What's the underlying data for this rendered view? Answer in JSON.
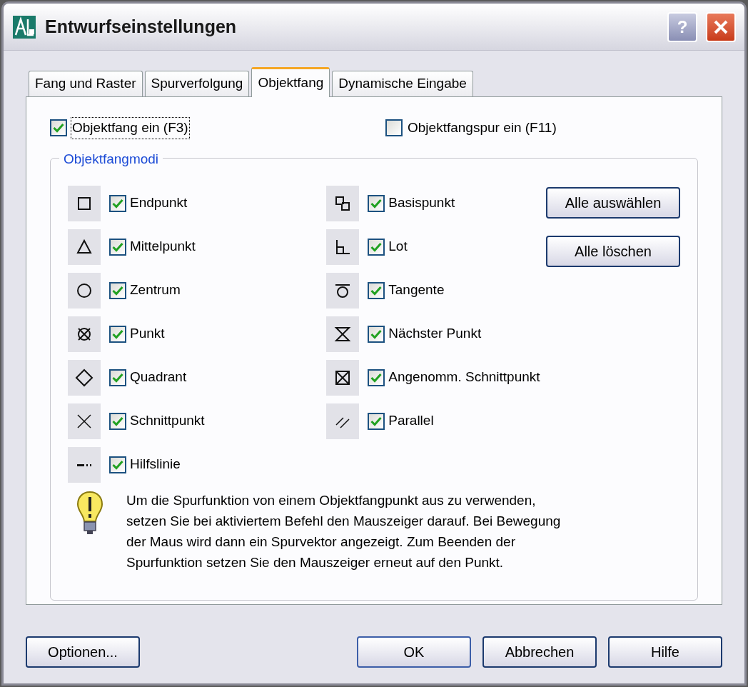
{
  "window": {
    "title": "Entwurfseinstellungen",
    "help_button": "?"
  },
  "tabs": [
    {
      "label": "Fang und Raster",
      "selected": false
    },
    {
      "label": "Spurverfolgung",
      "selected": false
    },
    {
      "label": "Objektfang",
      "selected": true
    },
    {
      "label": "Dynamische Eingabe",
      "selected": false
    }
  ],
  "top_options": [
    {
      "label": "Objektfang ein (F3)",
      "checked": true,
      "focused": true
    },
    {
      "label": "Objektfangspur ein (F11)",
      "checked": false,
      "focused": false
    }
  ],
  "group": {
    "title": "Objektfangmodi",
    "columns": [
      {
        "modes": [
          {
            "kind": "endpoint",
            "label": "Endpunkt",
            "checked": true
          },
          {
            "kind": "midpoint",
            "label": "Mittelpunkt",
            "checked": true
          },
          {
            "kind": "center",
            "label": "Zentrum",
            "checked": true
          },
          {
            "kind": "node",
            "label": "Punkt",
            "checked": true
          },
          {
            "kind": "quadrant",
            "label": "Quadrant",
            "checked": true
          },
          {
            "kind": "intersection",
            "label": "Schnittpunkt",
            "checked": true
          },
          {
            "kind": "extension",
            "label": "Hilfslinie",
            "checked": true
          }
        ]
      },
      {
        "modes": [
          {
            "kind": "insertion",
            "label": "Basispunkt",
            "checked": true
          },
          {
            "kind": "perpendicular",
            "label": "Lot",
            "checked": true
          },
          {
            "kind": "tangent",
            "label": "Tangente",
            "checked": true
          },
          {
            "kind": "nearest",
            "label": "Nächster Punkt",
            "checked": true
          },
          {
            "kind": "apparent",
            "label": "Angenomm. Schnittpunkt",
            "checked": true
          },
          {
            "kind": "parallel",
            "label": "Parallel",
            "checked": true
          }
        ]
      }
    ],
    "buttons": [
      "Alle auswählen",
      "Alle löschen"
    ],
    "hint": "Um die Spurfunktion von einem Objektfangpunkt aus zu verwenden, setzen Sie bei aktiviertem Befehl den Mauszeiger darauf. Bei Bewegung der Maus wird dann ein Spurvektor angezeigt. Zum Beenden der Spurfunktion setzen Sie den Mauszeiger erneut auf den Punkt."
  },
  "footer": {
    "left_button": "Optionen...",
    "buttons": [
      {
        "label": "OK",
        "default": true
      },
      {
        "label": "Abbrechen",
        "default": false
      },
      {
        "label": "Hilfe",
        "default": false
      }
    ]
  }
}
